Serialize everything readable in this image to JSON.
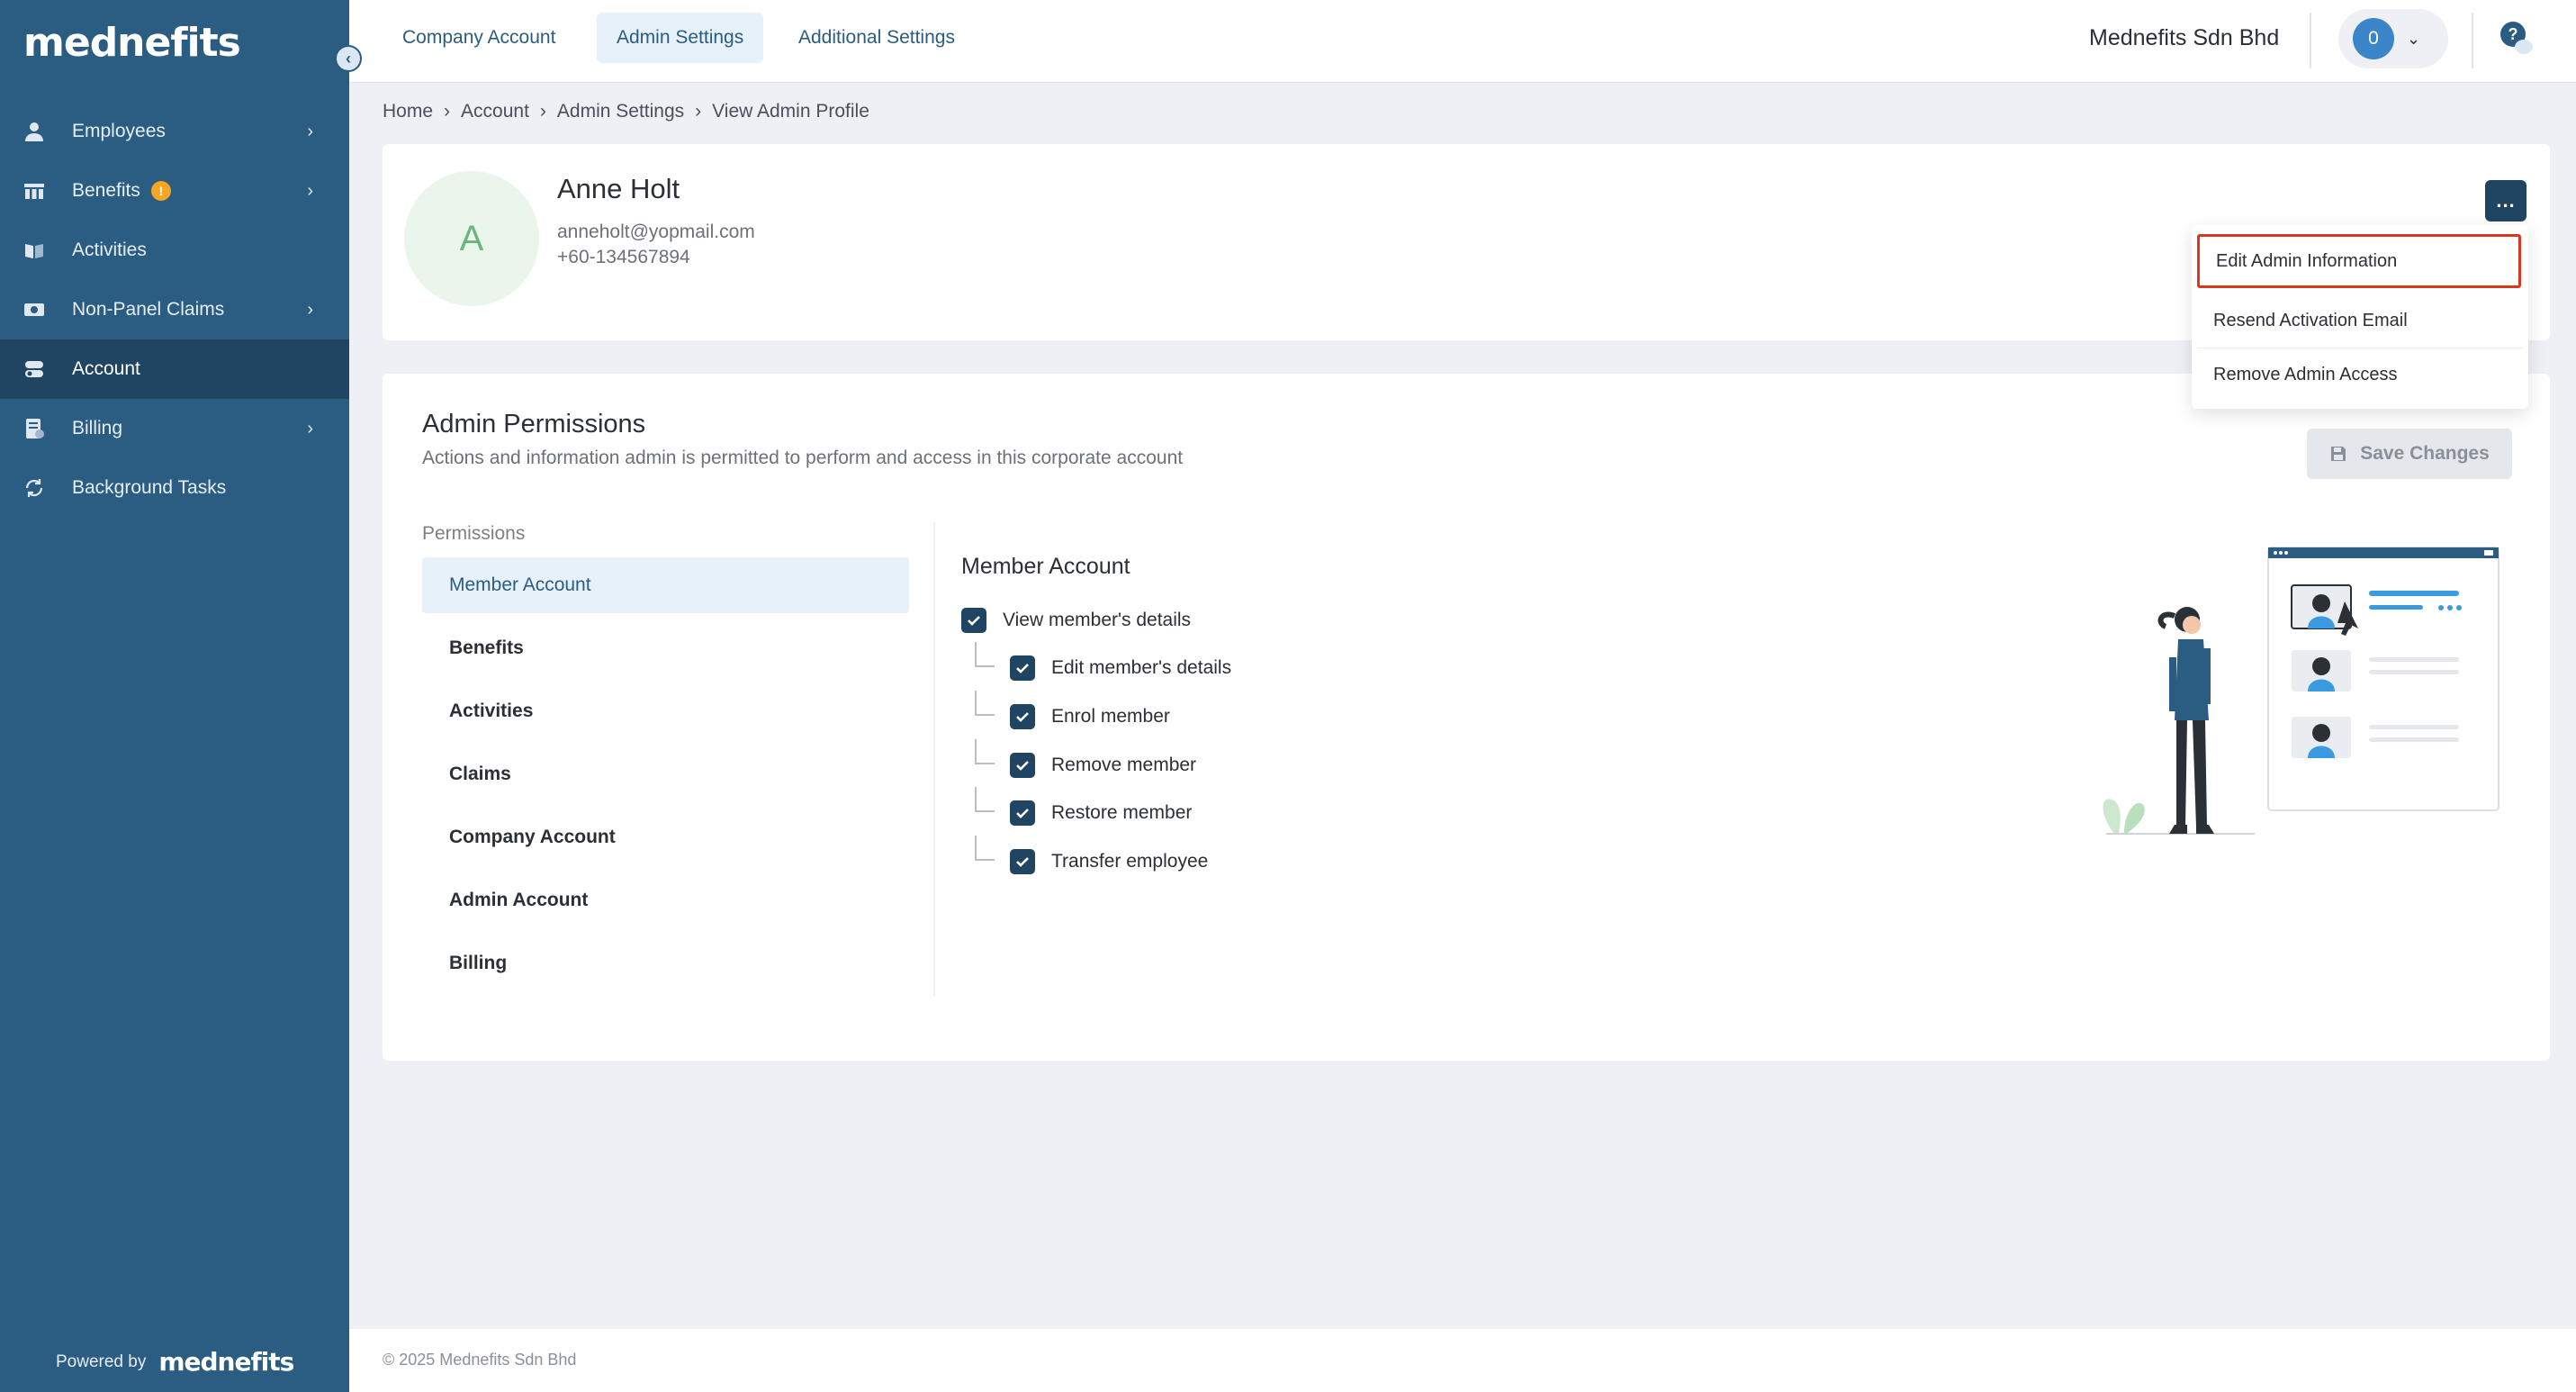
{
  "sidebar": {
    "logo": "mednefits",
    "items": [
      {
        "label": "Employees",
        "icon": "person-icon",
        "chevron": true
      },
      {
        "label": "Benefits",
        "icon": "benefits-icon",
        "chevron": true,
        "badge": "!"
      },
      {
        "label": "Activities",
        "icon": "book-icon",
        "chevron": false
      },
      {
        "label": "Non-Panel Claims",
        "icon": "cash-icon",
        "chevron": true
      },
      {
        "label": "Account",
        "icon": "account-icon",
        "chevron": false,
        "active": true
      },
      {
        "label": "Billing",
        "icon": "bill-icon",
        "chevron": true
      },
      {
        "label": "Background Tasks",
        "icon": "sync-icon",
        "chevron": false
      }
    ],
    "powered_by": "Powered by",
    "powered_logo": "mednefits"
  },
  "topbar": {
    "tabs": [
      "Company Account",
      "Admin Settings",
      "Additional Settings"
    ],
    "active_tab": "Admin Settings",
    "company": "Mednefits Sdn Bhd",
    "user_initial": "0",
    "help": "?"
  },
  "breadcrumb": [
    "Home",
    "Account",
    "Admin Settings",
    "View Admin Profile"
  ],
  "profile": {
    "initial": "A",
    "name": "Anne Holt",
    "email": "anneholt@yopmail.com",
    "phone": "+60-134567894",
    "more": "..."
  },
  "dropdown": {
    "items": [
      "Edit Admin Information",
      "Resend Activation Email",
      "Remove Admin Access"
    ],
    "highlighted": "Edit Admin Information"
  },
  "permissions": {
    "title": "Admin Permissions",
    "subtitle": "Actions and information admin is permitted to perform and access in this corporate account",
    "save_label": "Save Changes",
    "list_label": "Permissions",
    "categories": [
      "Member Account",
      "Benefits",
      "Activities",
      "Claims",
      "Company Account",
      "Admin Account",
      "Billing"
    ],
    "active_category": "Member Account",
    "section_title": "Member Account",
    "parent_check": {
      "label": "View member's details",
      "checked": true
    },
    "child_checks": [
      {
        "label": "Edit member's details",
        "checked": true
      },
      {
        "label": "Enrol member",
        "checked": true
      },
      {
        "label": "Remove member",
        "checked": true
      },
      {
        "label": "Restore member",
        "checked": true
      },
      {
        "label": "Transfer employee",
        "checked": true
      }
    ]
  },
  "footer": {
    "copyright": "© 2025 Mednefits Sdn Bhd"
  },
  "colors": {
    "sidebar": "#2b5c82",
    "sidebar_active": "#1f4563",
    "accent": "#2b5c82",
    "highlight_border": "#d9381e",
    "badge": "#f5a623"
  }
}
